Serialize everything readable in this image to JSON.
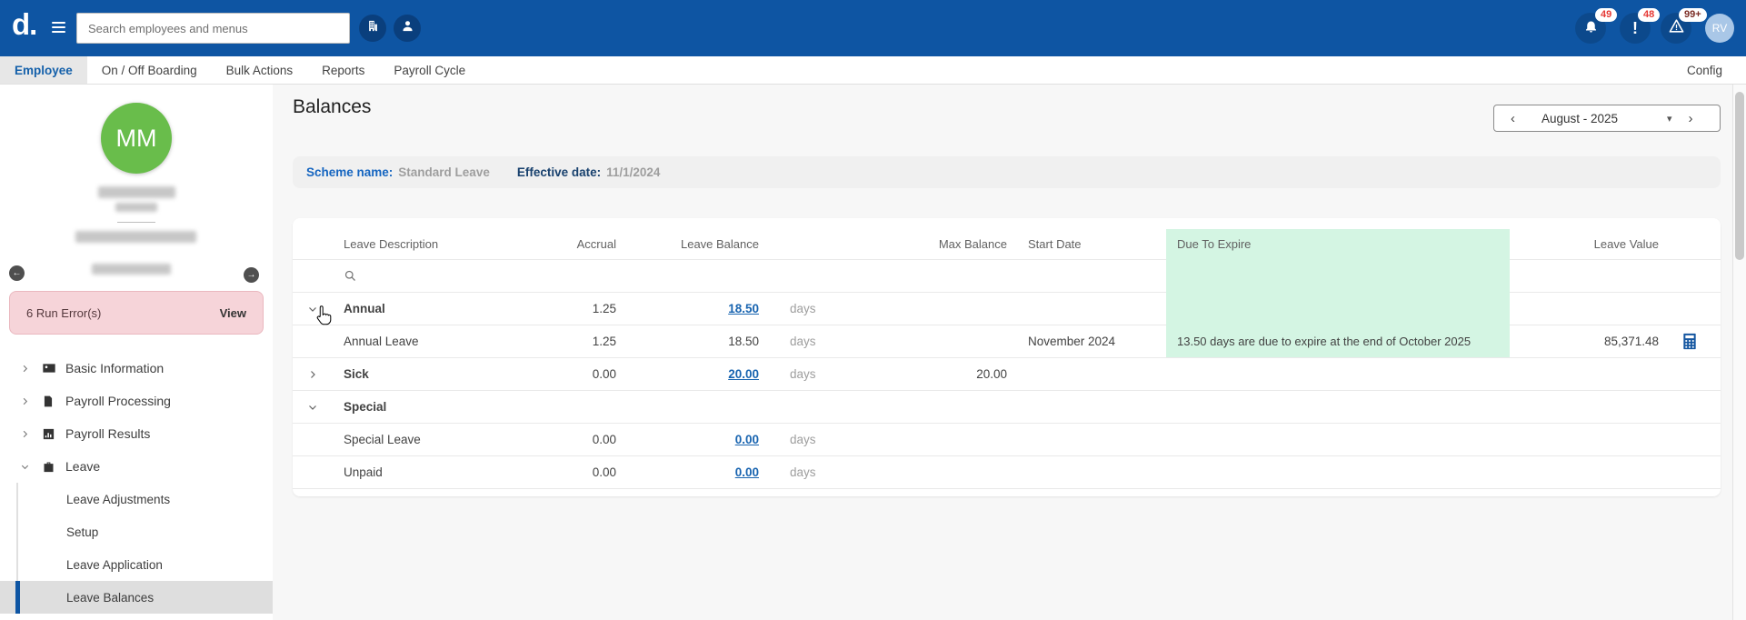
{
  "header": {
    "logo": "d.",
    "search_placeholder": "Search employees and menus",
    "badges": {
      "bell": "49",
      "alerts": "48",
      "warnings": "99+"
    },
    "user_initials": "RV"
  },
  "nav": {
    "tabs": [
      {
        "label": "Employee"
      },
      {
        "label": "On / Off Boarding"
      },
      {
        "label": "Bulk Actions"
      },
      {
        "label": "Reports"
      },
      {
        "label": "Payroll Cycle"
      }
    ],
    "config": "Config"
  },
  "profile": {
    "initials": "MM",
    "alert_text": "6 Run Error(s)",
    "alert_action": "View"
  },
  "sidebar": {
    "items": [
      {
        "label": "Basic Information"
      },
      {
        "label": "Payroll Processing"
      },
      {
        "label": "Payroll Results"
      },
      {
        "label": "Leave"
      }
    ],
    "subitems": [
      {
        "label": "Leave Adjustments"
      },
      {
        "label": "Setup"
      },
      {
        "label": "Leave Application"
      },
      {
        "label": "Leave Balances"
      }
    ]
  },
  "icons": {
    "prev_month": "‹",
    "next_month": "›",
    "caret_down": "▾",
    "prev_employee": "←",
    "next_employee": "→"
  },
  "main": {
    "title": "Balances",
    "period": {
      "label": "August - 2025"
    },
    "scheme": {
      "name_label": "Scheme name:",
      "name_value": "Standard Leave",
      "date_label": "Effective date:",
      "date_value": "11/1/2024"
    },
    "table": {
      "columns": [
        "Leave Description",
        "Accrual",
        "Leave Balance",
        "Max Balance",
        "Start Date",
        "Due To Expire",
        "Leave Value"
      ],
      "rows": [
        {
          "name": "Annual",
          "accrual": "1.25",
          "balance": "18.50",
          "unit": "days"
        },
        {
          "name": "Annual Leave",
          "accrual": "1.25",
          "balance": "18.50",
          "unit": "days",
          "start": "November 2024",
          "expire": "13.50 days are due to expire at the end of October 2025",
          "value": "85,371.48"
        },
        {
          "name": "Sick",
          "accrual": "0.00",
          "balance": "20.00",
          "unit": "days",
          "max": "20.00"
        },
        {
          "name": "Special"
        },
        {
          "name": "Special Leave",
          "accrual": "0.00",
          "balance": "0.00",
          "unit": "days"
        },
        {
          "name": "Unpaid",
          "accrual": "0.00",
          "balance": "0.00",
          "unit": "days"
        }
      ]
    }
  },
  "colors": {
    "header_blue": "#0e55a3",
    "link_blue": "#1864b0",
    "expire_green": "#d4f5e3",
    "avatar_green": "#69bd4b",
    "error_pink": "#f6d4d9"
  }
}
